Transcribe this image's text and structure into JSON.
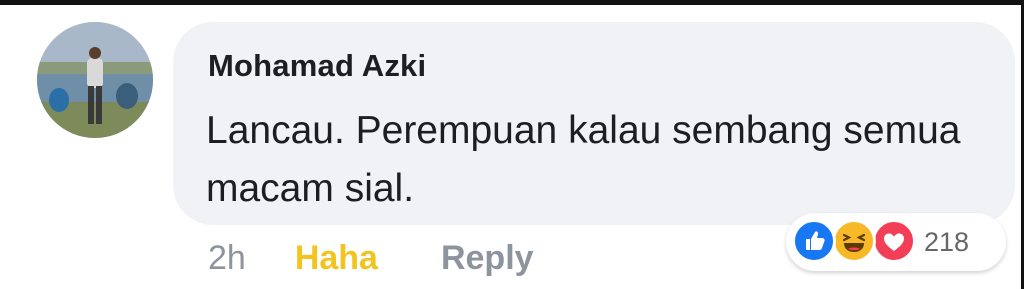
{
  "comment": {
    "author": "Mohamad Azki",
    "text": "Lancau. Perempuan kalau sembang semua macam sial.",
    "time": "2h",
    "reaction_label": "Haha",
    "reply_label": "Reply"
  },
  "reactions": {
    "icons": [
      "like-icon",
      "haha-icon",
      "love-icon"
    ],
    "count": "218"
  },
  "colors": {
    "bubble": "#f0f2f5",
    "haha_active": "#f3c41f",
    "muted": "#8d949e",
    "like": "#1877f2",
    "haha": "#f7b928",
    "love": "#f33e58"
  }
}
